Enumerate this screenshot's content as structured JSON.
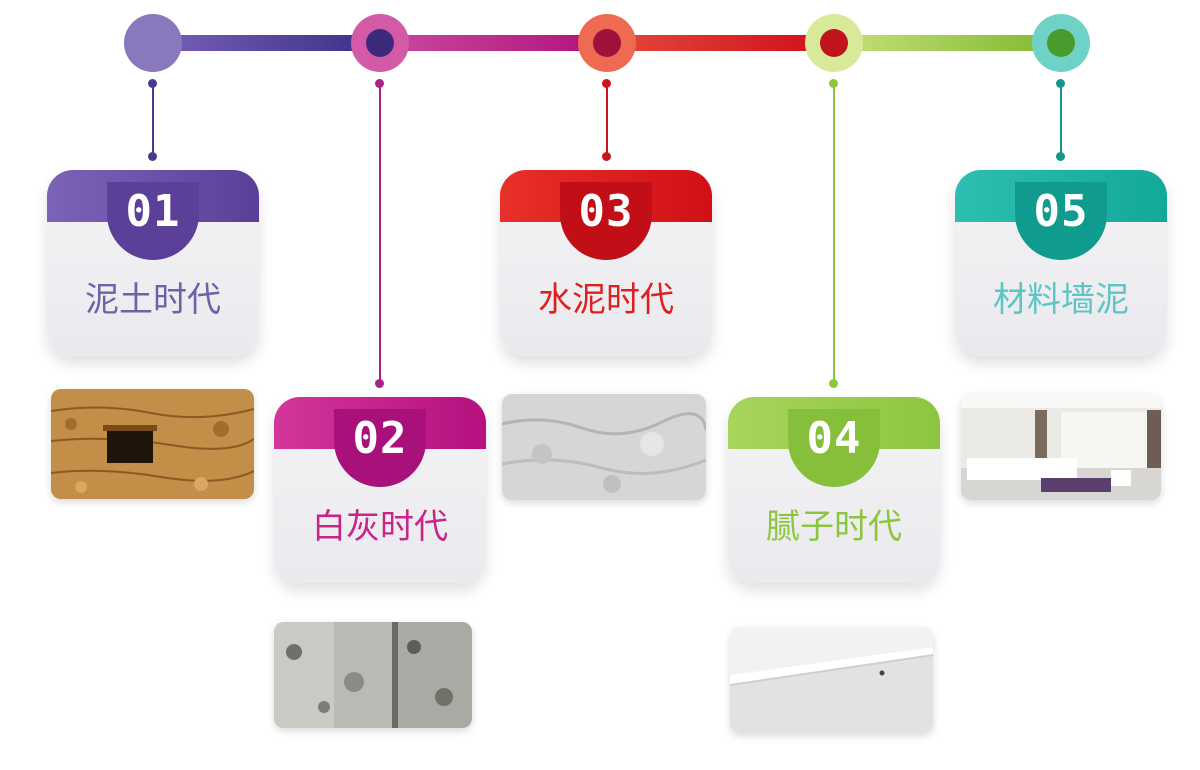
{
  "timeline": {
    "steps": [
      {
        "number": "01",
        "label": "泥土时代",
        "color": "#6a4fa3",
        "text_color": "#6b63a8"
      },
      {
        "number": "02",
        "label": "白灰时代",
        "color": "#c2157f",
        "text_color": "#c7258a"
      },
      {
        "number": "03",
        "label": "水泥时代",
        "color": "#d81e1e",
        "text_color": "#e02020"
      },
      {
        "number": "04",
        "label": "腻子时代",
        "color": "#8dc63f",
        "text_color": "#8cc63f"
      },
      {
        "number": "05",
        "label": "材料墙泥",
        "color": "#1ab0a0",
        "text_color": "#5cc6c6"
      }
    ]
  }
}
